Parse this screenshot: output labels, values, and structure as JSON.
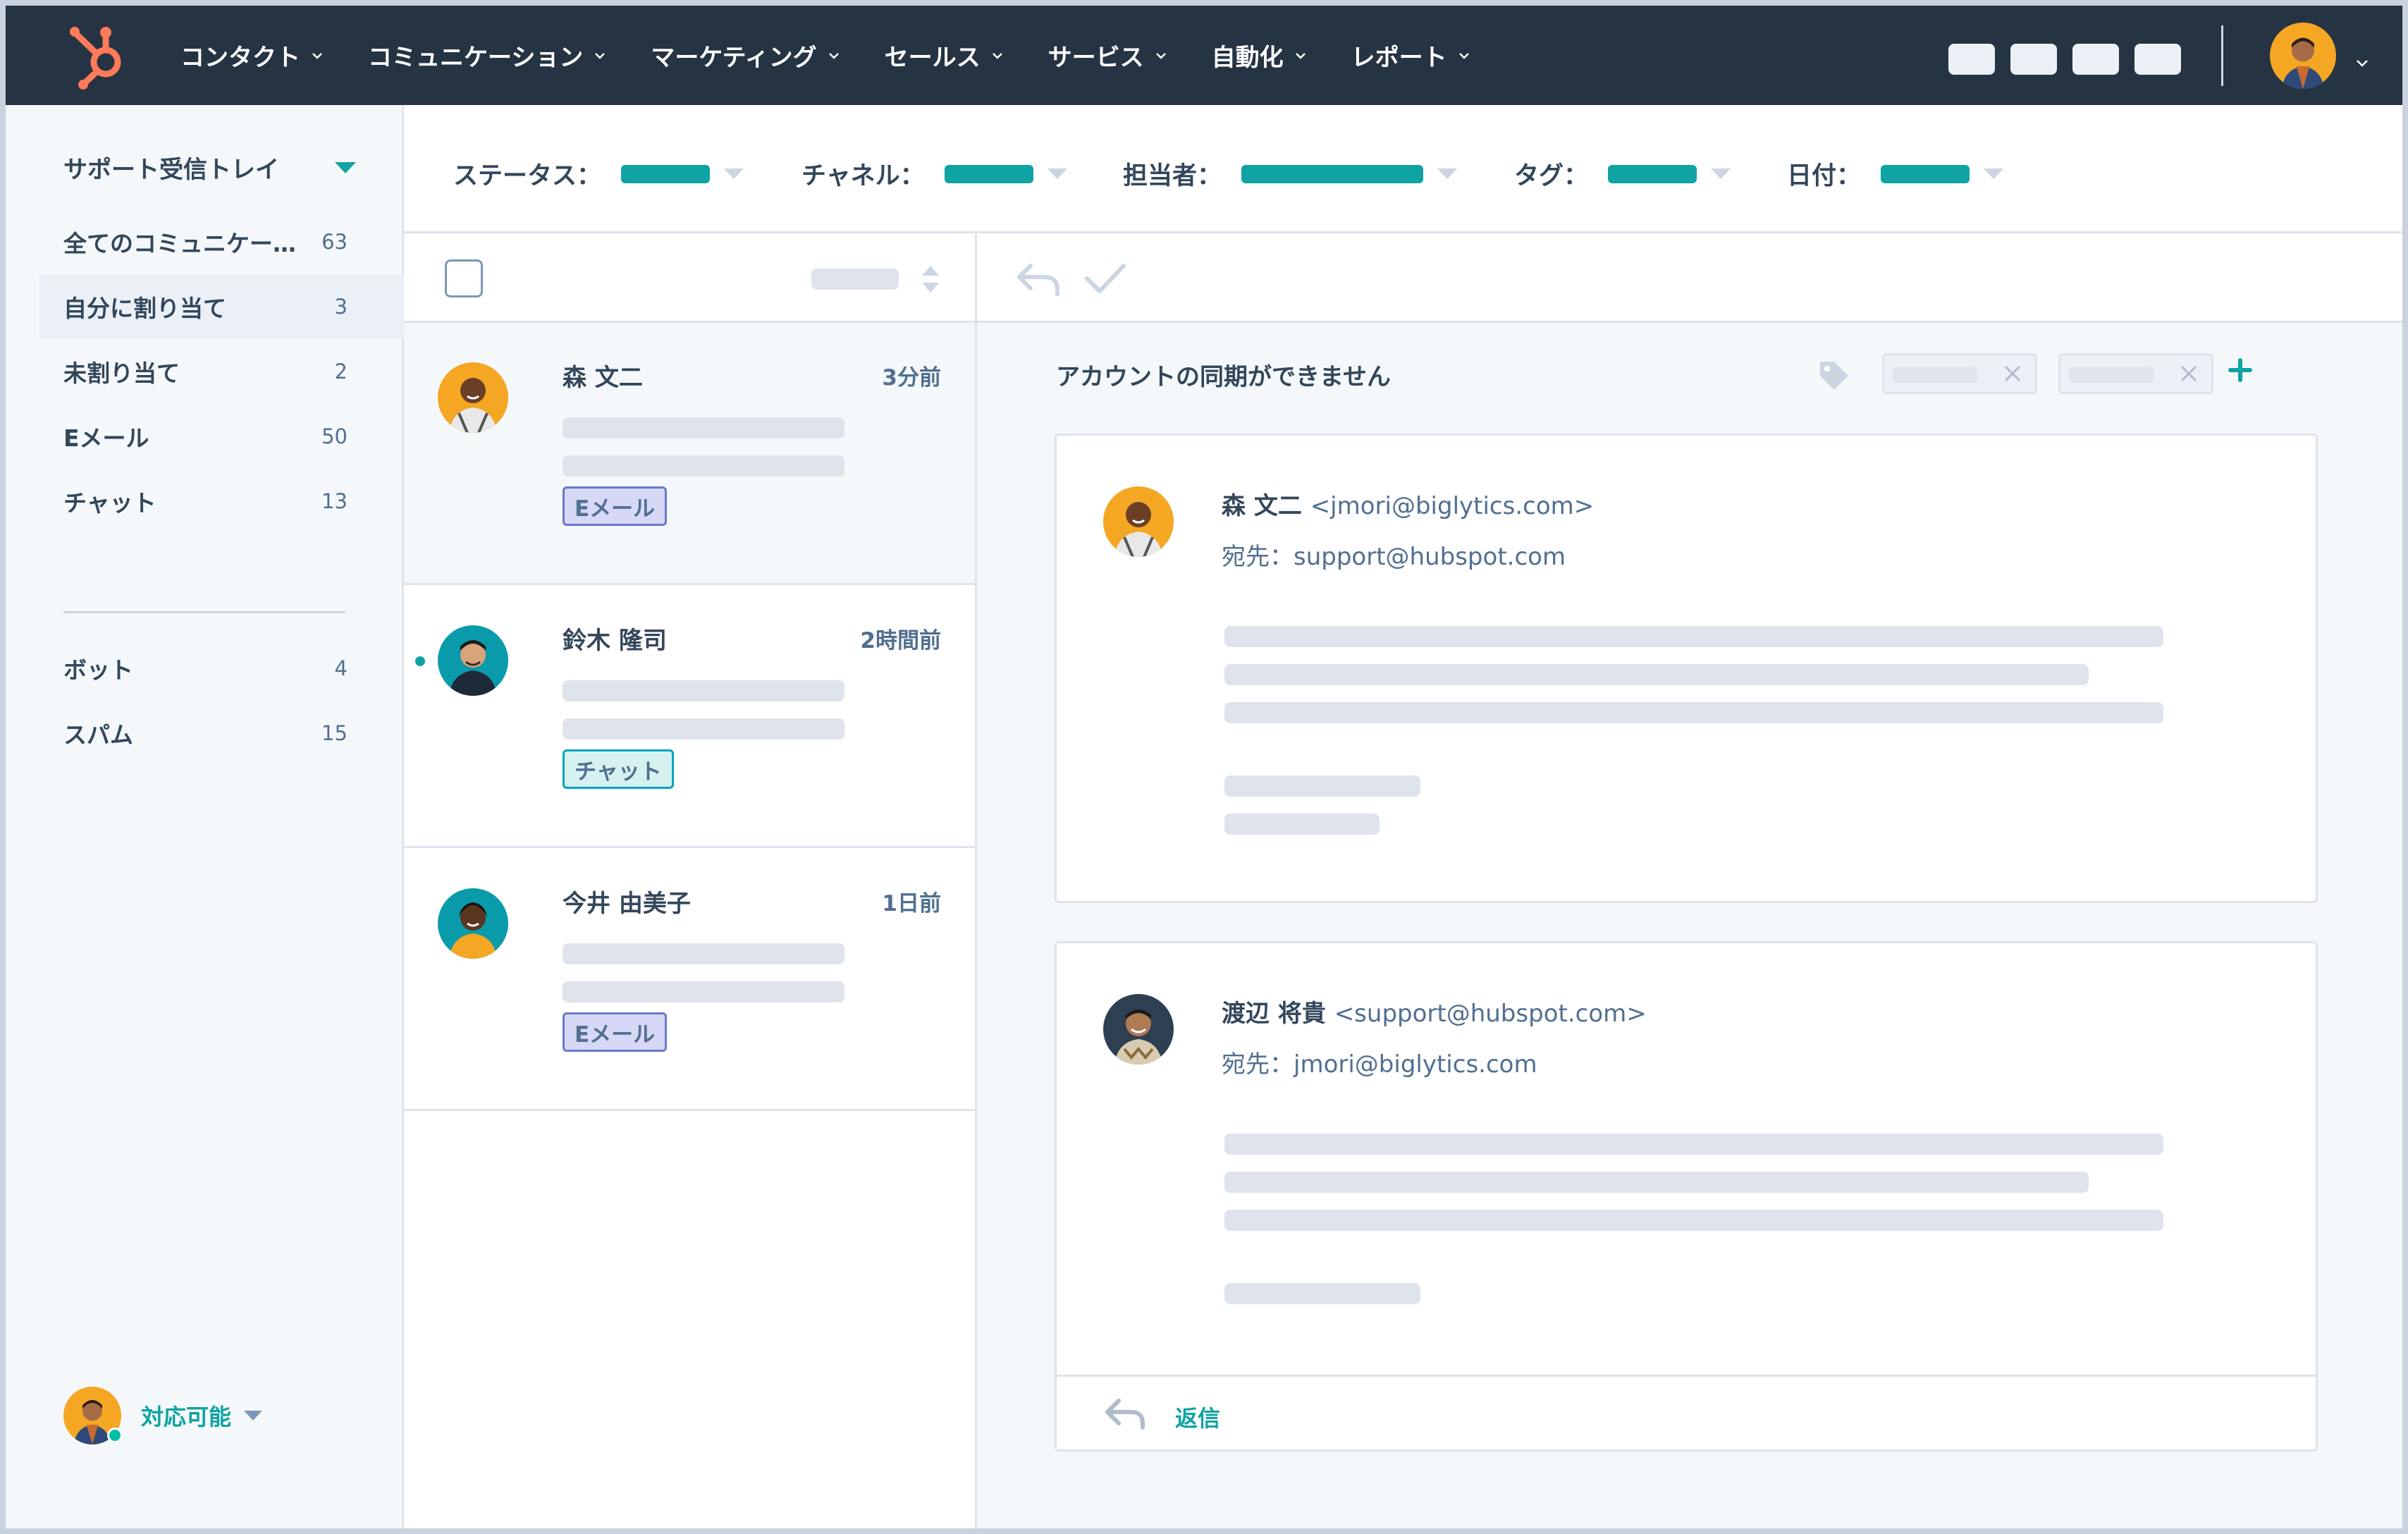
{
  "nav": {
    "items": [
      {
        "label": "コンタクト"
      },
      {
        "label": "コミュニケーション"
      },
      {
        "label": "マーケティング"
      },
      {
        "label": "セールス"
      },
      {
        "label": "サービス"
      },
      {
        "label": "自動化"
      },
      {
        "label": "レポート"
      }
    ],
    "logo_icon": "sprocket-logo-icon",
    "accent_color": "#ff7a59"
  },
  "sidebar": {
    "inbox_title": "サポート受信トレイ",
    "folders": [
      {
        "label": "全てのコミュニケー…",
        "count": "63"
      },
      {
        "label": "自分に割り当て",
        "count": "3"
      },
      {
        "label": "未割り当て",
        "count": "2"
      },
      {
        "label": "Eメール",
        "count": "50"
      },
      {
        "label": "チャット",
        "count": "13"
      },
      {
        "label": "ボット",
        "count": "4"
      },
      {
        "label": "スパム",
        "count": "15"
      }
    ],
    "availability": "対応可能"
  },
  "filters": {
    "status": "ステータス：",
    "channel": "チャネル：",
    "owner": "担当者：",
    "tag": "タグ：",
    "date": "日付："
  },
  "conversations": [
    {
      "name": "森 文二",
      "time": "3分前",
      "channel": "Eメール"
    },
    {
      "name": "鈴木 隆司",
      "time": "2時間前",
      "channel": "チャット"
    },
    {
      "name": "今井 由美子",
      "time": "1日前",
      "channel": "Eメール"
    }
  ],
  "thread": {
    "subject": "アカウントの同期ができません",
    "messages": [
      {
        "sender": "森 文二",
        "address": "<jmori@biglytics.com>",
        "recipient": "宛先：support@hubspot.com"
      },
      {
        "sender": "渡辺 将貴",
        "address": "<support@hubspot.com>",
        "recipient": "宛先：jmori@biglytics.com"
      }
    ],
    "reply_label": "返信"
  },
  "colors": {
    "nav_bg": "#253342",
    "teal": "#0fa3a3",
    "email_tag": "#6a78d1",
    "chat_tag": "#00a4bd"
  }
}
